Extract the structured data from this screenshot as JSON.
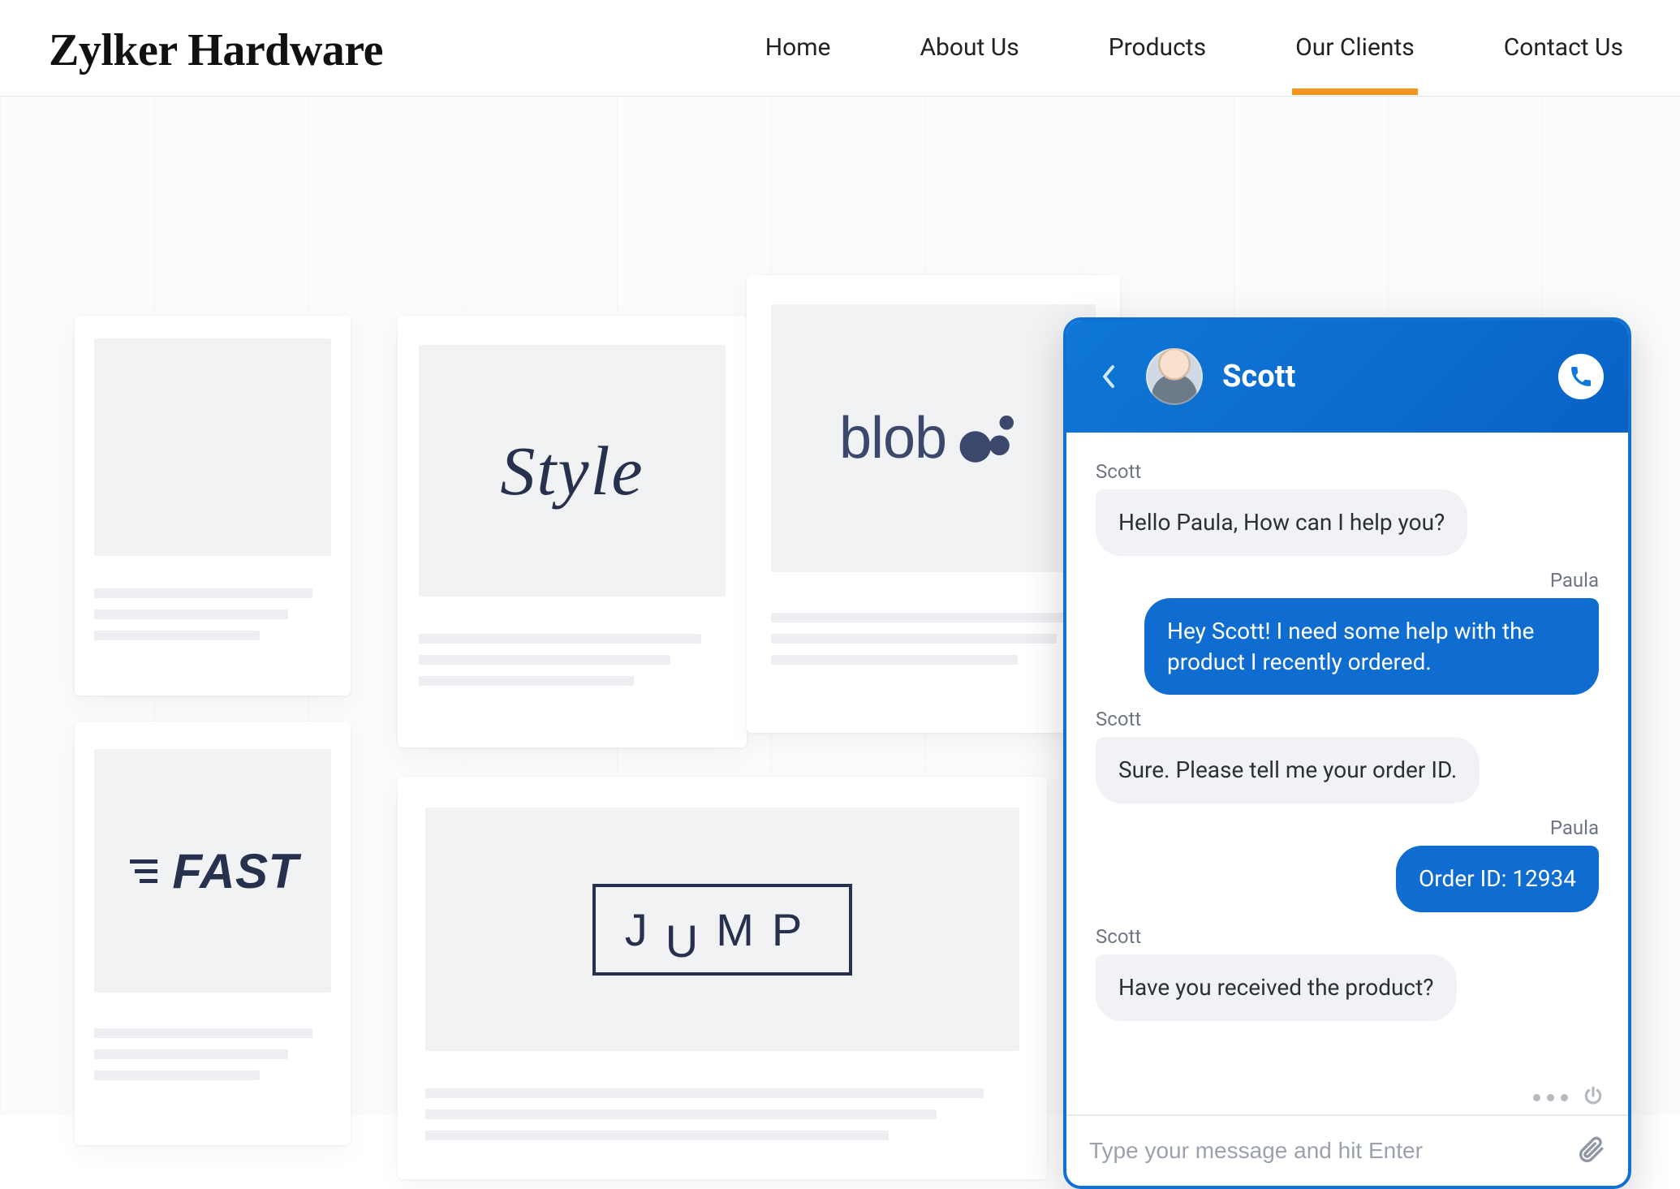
{
  "brand": "Zylker Hardware",
  "nav": {
    "home": "Home",
    "about": "About Us",
    "products": "Products",
    "clients": "Our Clients",
    "contact": "Contact Us",
    "active": "clients"
  },
  "clients": {
    "style": "Style",
    "blob": "blob",
    "fast": "FAST",
    "jump": "JUMP"
  },
  "chat": {
    "agent_name": "Scott",
    "input_placeholder": "Type your message and hit Enter",
    "messages": [
      {
        "from": "agent",
        "name": "Scott",
        "text": "Hello Paula, How can I help you?"
      },
      {
        "from": "user",
        "name": "Paula",
        "text": "Hey Scott! I need some help with the product I recently ordered."
      },
      {
        "from": "agent",
        "name": "Scott",
        "text": "Sure. Please tell me your order ID."
      },
      {
        "from": "user",
        "name": "Paula",
        "text": "Order ID: 12934"
      },
      {
        "from": "agent",
        "name": "Scott",
        "text": "Have you received the product?"
      }
    ]
  }
}
